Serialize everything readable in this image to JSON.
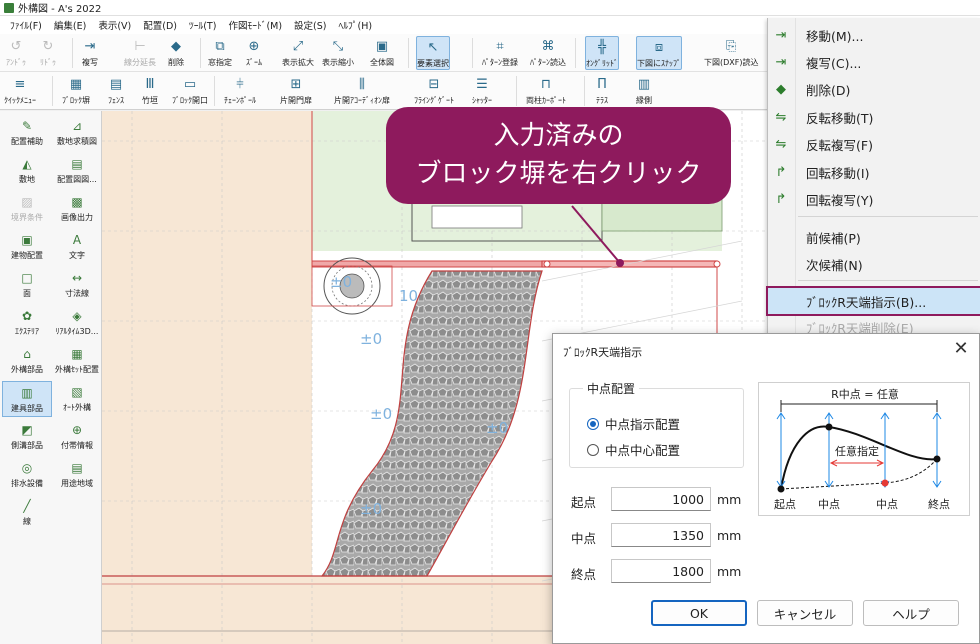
{
  "window": {
    "title": "外構図 - A's 2022"
  },
  "menubar": [
    "ﾌｧｲﾙ(F)",
    "編集(E)",
    "表示(V)",
    "配置(D)",
    "ﾂｰﾙ(T)",
    "作図ﾓｰﾄﾞ(M)",
    "設定(S)",
    "ﾍﾙﾌﾟ(H)"
  ],
  "ribbon1": [
    {
      "label": "ｱﾝﾄﾞｩ",
      "icon": "undo-icon",
      "glyph": "↺",
      "disabled": true
    },
    {
      "label": "ﾘﾄﾞｩ",
      "icon": "redo-icon",
      "glyph": "↻",
      "disabled": true
    },
    {
      "label": "複写",
      "icon": "copy-icon",
      "glyph": "⇥",
      "disabled": false
    },
    {
      "label": "線分延長",
      "icon": "extend-line-icon",
      "glyph": "⊢",
      "disabled": true
    },
    {
      "label": "削除",
      "icon": "eraser-icon",
      "glyph": "◆",
      "disabled": false
    },
    {
      "label": "窓指定",
      "icon": "window-select-icon",
      "glyph": "⧉",
      "disabled": false
    },
    {
      "label": "ｽﾞｰﾑ",
      "icon": "zoom-icon",
      "glyph": "⊕",
      "disabled": false
    },
    {
      "label": "表示拡大",
      "icon": "zoom-in-icon",
      "glyph": "⤢",
      "disabled": false
    },
    {
      "label": "表示縮小",
      "icon": "zoom-out-icon",
      "glyph": "⤡",
      "disabled": false
    },
    {
      "label": "全体図",
      "icon": "fit-all-icon",
      "glyph": "▣",
      "disabled": false
    },
    {
      "label": "要素選択",
      "icon": "pointer-icon",
      "glyph": "↖",
      "disabled": false,
      "active": true
    },
    {
      "label": "ﾊﾟﾀｰﾝ登録",
      "icon": "pattern-register-icon",
      "glyph": "⌗",
      "disabled": false
    },
    {
      "label": "ﾊﾟﾀｰﾝ読込",
      "icon": "pattern-load-icon",
      "glyph": "⌘",
      "disabled": false
    },
    {
      "label": "ｵﾝｸﾞﾘｯﾄﾞ",
      "icon": "on-grid-icon",
      "glyph": "╬",
      "disabled": false,
      "active": true
    },
    {
      "label": "下図にｽﾅｯﾌﾟ",
      "icon": "snap-icon",
      "glyph": "⧈",
      "disabled": false,
      "active": true
    },
    {
      "label": "下図(DXF)読込",
      "icon": "dxf-load-icon",
      "glyph": "⎘",
      "disabled": false
    }
  ],
  "ribbon2": [
    {
      "label": "ｸｲｯｸﾒﾆｭｰ",
      "icon": "quick-menu-icon",
      "glyph": "≡"
    },
    {
      "label": "ﾌﾞﾛｯｸ塀",
      "icon": "block-wall-icon",
      "glyph": "▦"
    },
    {
      "label": "ﾌｪﾝｽ",
      "icon": "fence-icon",
      "glyph": "▤"
    },
    {
      "label": "竹垣",
      "icon": "bamboo-fence-icon",
      "glyph": "Ⅲ"
    },
    {
      "label": "ﾌﾞﾛｯｸ開口",
      "icon": "block-opening-icon",
      "glyph": "▭"
    },
    {
      "label": "ﾁｪｰﾝﾎﾟｰﾙ",
      "icon": "chain-pole-icon",
      "glyph": "⫩"
    },
    {
      "label": "片開門扉",
      "icon": "single-gate-icon",
      "glyph": "⊞"
    },
    {
      "label": "片開ｱｺｰﾃﾞｨｵﾝ扉",
      "icon": "accordion-gate-icon",
      "glyph": "⫼"
    },
    {
      "label": "ﾌﾗｲﾝｸﾞｹﾞｰﾄ",
      "icon": "flying-gate-icon",
      "glyph": "⊟"
    },
    {
      "label": "ｼｬｯﾀｰ",
      "icon": "shutter-icon",
      "glyph": "☰"
    },
    {
      "label": "両柱ｶｰﾎﾟｰﾄ",
      "icon": "carport-icon",
      "glyph": "⊓"
    },
    {
      "label": "ﾃﾗｽ",
      "icon": "terrace-icon",
      "glyph": "Π"
    },
    {
      "label": "縁側",
      "icon": "veranda-icon",
      "glyph": "▥"
    }
  ],
  "leftpanel": [
    {
      "label": "配置補助",
      "icon": "placement-assist-icon",
      "glyph": "✎"
    },
    {
      "label": "敷地求積図",
      "icon": "site-area-icon",
      "glyph": "⊿"
    },
    {
      "label": "敷地",
      "icon": "site-icon",
      "glyph": "◭"
    },
    {
      "label": "配置図図...",
      "icon": "layout-drawing-icon",
      "glyph": "▤"
    },
    {
      "label": "境界条件",
      "icon": "boundary-icon",
      "glyph": "▨",
      "disabled": true
    },
    {
      "label": "画像出力",
      "icon": "image-output-icon",
      "glyph": "▩"
    },
    {
      "label": "建物配置",
      "icon": "building-place-icon",
      "glyph": "▣"
    },
    {
      "label": "文字",
      "icon": "text-icon",
      "glyph": "A"
    },
    {
      "label": "面",
      "icon": "face-icon",
      "glyph": "□"
    },
    {
      "label": "寸法線",
      "icon": "dimension-icon",
      "glyph": "↔"
    },
    {
      "label": "ｴｸｽﾃﾘｱ",
      "icon": "exterior-icon",
      "glyph": "✿"
    },
    {
      "label": "ﾘｱﾙﾀｲﾑ3D...",
      "icon": "realtime-3d-icon",
      "glyph": "◈"
    },
    {
      "label": "外構部品",
      "icon": "exterior-parts-icon",
      "glyph": "⌂"
    },
    {
      "label": "外構ｾｯﾄ配置",
      "icon": "exterior-set-icon",
      "glyph": "▦"
    },
    {
      "label": "建具部品",
      "icon": "fittings-icon",
      "glyph": "▥",
      "active": true
    },
    {
      "label": "ｵｰﾄ外構",
      "icon": "auto-exterior-icon",
      "glyph": "▧"
    },
    {
      "label": "側溝部品",
      "icon": "gutter-icon",
      "glyph": "◩"
    },
    {
      "label": "付帯情報",
      "icon": "info-icon",
      "glyph": "⊕"
    },
    {
      "label": "排水設備",
      "icon": "drainage-icon",
      "glyph": "◎"
    },
    {
      "label": "用途地域",
      "icon": "zoning-icon",
      "glyph": "▤"
    },
    {
      "label": "線",
      "icon": "line-icon",
      "glyph": "╱"
    }
  ],
  "canvas": {
    "labels": [
      "10",
      "±0",
      "±0",
      "±0",
      "±0",
      "±0"
    ]
  },
  "callout": {
    "line1": "入力済みの",
    "line2": "ブロック塀を右クリック"
  },
  "context_menu": [
    {
      "label": "移動(M)...",
      "icon": "move-icon",
      "glyph": "⇥"
    },
    {
      "label": "複写(C)...",
      "icon": "copy-icon",
      "glyph": "⇥"
    },
    {
      "label": "削除(D)",
      "icon": "eraser-icon",
      "glyph": "◆"
    },
    {
      "label": "反転移動(T)",
      "icon": "mirror-move-icon",
      "glyph": "⇋"
    },
    {
      "label": "反転複写(F)",
      "icon": "mirror-copy-icon",
      "glyph": "⇋"
    },
    {
      "label": "回転移動(I)",
      "icon": "rotate-move-icon",
      "glyph": "↱"
    },
    {
      "label": "回転複写(Y)",
      "icon": "rotate-copy-icon",
      "glyph": "↱"
    },
    {
      "label": "前候補(P)",
      "icon": "",
      "glyph": ""
    },
    {
      "label": "次候補(N)",
      "icon": "",
      "glyph": ""
    },
    {
      "label": "ﾌﾞﾛｯｸR天端指示(B)...",
      "icon": "",
      "glyph": "",
      "highlighted": true
    },
    {
      "label": "ﾌﾞﾛｯｸR天端削除(E)",
      "icon": "",
      "glyph": "",
      "disabled": true
    }
  ],
  "dialog": {
    "title": "ﾌﾞﾛｯｸR天端指示",
    "close": "✕",
    "group_label": "中点配置",
    "radios": [
      {
        "label": "中点指示配置",
        "checked": true
      },
      {
        "label": "中点中心配置",
        "checked": false
      }
    ],
    "fields": [
      {
        "label": "起点",
        "value": "1000",
        "unit": "mm"
      },
      {
        "label": "中点",
        "value": "1350",
        "unit": "mm"
      },
      {
        "label": "終点",
        "value": "1800",
        "unit": "mm"
      }
    ],
    "preview": {
      "title": "R中点 = 任意",
      "range_label": "任意指定",
      "bottom_labels": [
        "起点",
        "中点",
        "中点",
        "終点"
      ]
    },
    "buttons": {
      "ok": "OK",
      "cancel": "キャンセル",
      "help": "ヘルプ"
    }
  },
  "colors": {
    "accent": "#8e1a5d",
    "selection": "#cce4f7",
    "wall": "#e06a6a",
    "lawn": "#e4f1dc",
    "ground": "#f7e7d5"
  }
}
